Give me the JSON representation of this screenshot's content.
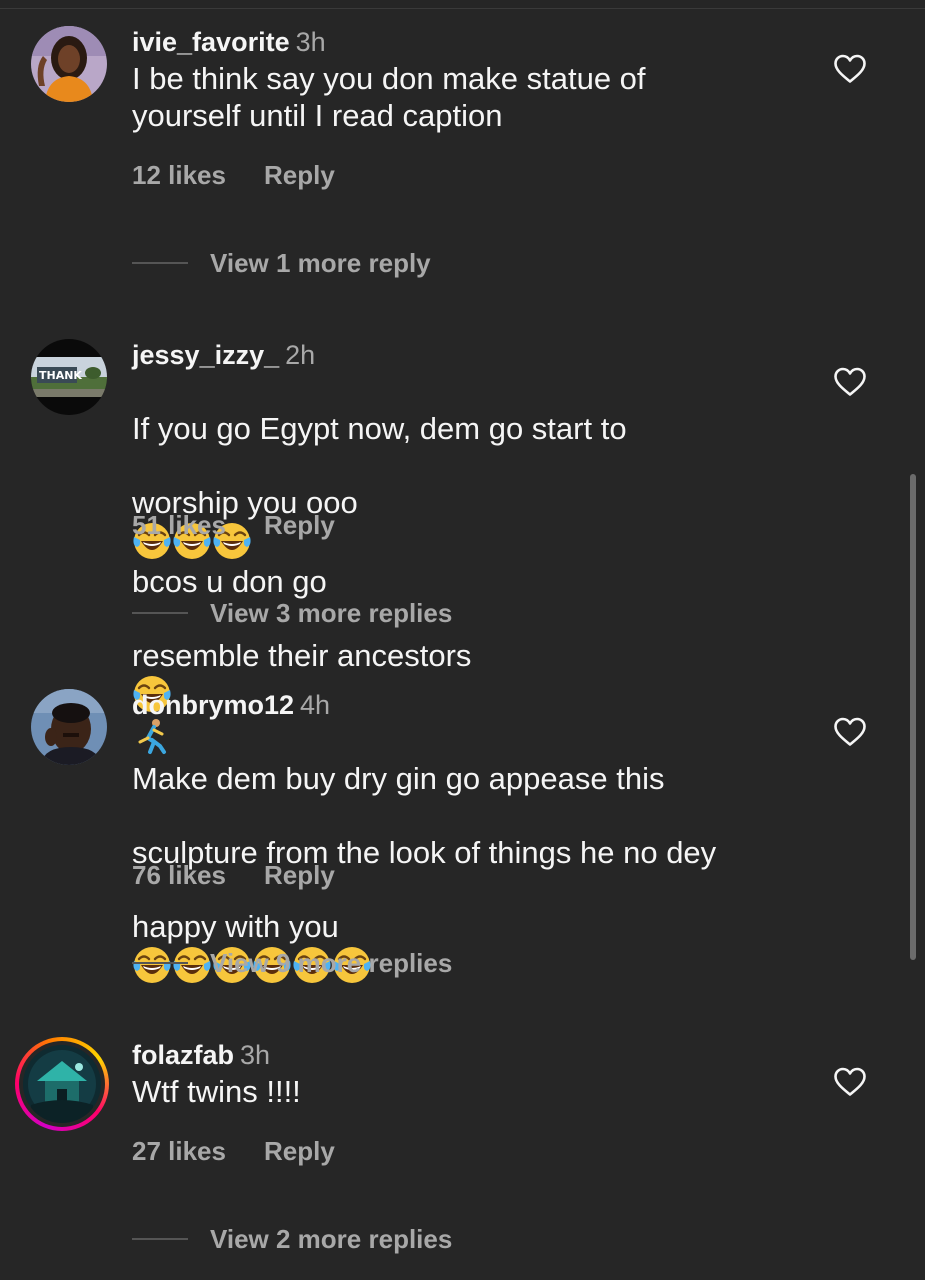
{
  "comments": [
    {
      "username": "ivie_favorite",
      "time": "3h",
      "text": "I be think say you don make statue of\nyourself until I read caption",
      "likes": "12 likes",
      "reply_label": "Reply",
      "view_more": "View 1 more reply"
    },
    {
      "username": "jessy_izzy_",
      "time": "2h",
      "text_line1": "If you go Egypt now, dem go start to",
      "text_line2a": "worship you ooo",
      "text_line2b": "bcos u don go",
      "text_line3": "resemble their ancestors",
      "likes": "51 likes",
      "reply_label": "Reply",
      "view_more": "View 3 more replies"
    },
    {
      "username": "donbrymo12",
      "time": "4h",
      "text_line1": "Make dem buy dry gin go appease this",
      "text_line2": "sculpture from the look of things he no dey",
      "text_line3": "happy with you",
      "likes": "76 likes",
      "reply_label": "Reply",
      "view_more": "View 9 more replies"
    },
    {
      "username": "folazfab",
      "time": "3h",
      "text": "Wtf twins !!!!",
      "likes": "27 likes",
      "reply_label": "Reply",
      "view_more": "View 2 more replies"
    }
  ],
  "icons": {
    "like": "heart-outline-icon",
    "laugh": "face-with-tears-of-joy-emoji",
    "run": "person-running-emoji"
  },
  "colors": {
    "background": "#262626",
    "primary_text": "#f5f5f5",
    "secondary_text": "#a8a8a8"
  }
}
